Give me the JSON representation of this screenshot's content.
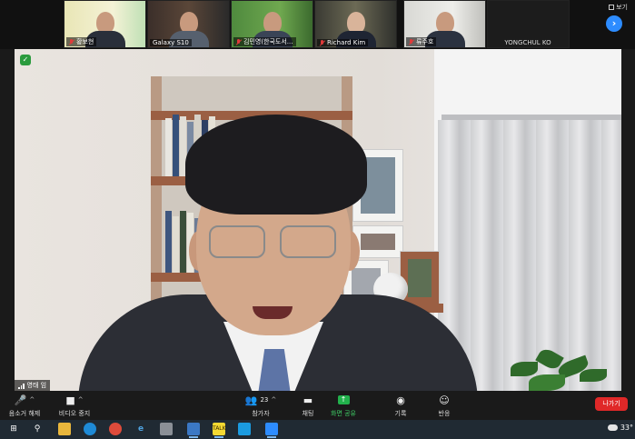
{
  "gallery": {
    "participants": [
      {
        "name": "황보현",
        "muted": true
      },
      {
        "name": "Galaxy S10",
        "muted": false
      },
      {
        "name": "김민영(한국도서...",
        "muted": true
      },
      {
        "name": "Richard Kim",
        "muted": true
      },
      {
        "name": "류주호",
        "muted": true
      },
      {
        "name": "YONGCHUL KO",
        "muted": false
      }
    ],
    "view_label": "보기",
    "next_arrow": "›"
  },
  "main_video": {
    "speaker_name": "영태 임",
    "security_icon": "shield-check-icon"
  },
  "controls": {
    "unmute_label": "음소거 해제",
    "stop_video_label": "비디오 중지",
    "participants_label": "참가자",
    "participants_count": "23",
    "chat_label": "채팅",
    "share_label": "화면 공유",
    "record_label": "기록",
    "reactions_label": "반응",
    "leave_label": "나가기"
  },
  "taskbar": {
    "temperature": "33°"
  },
  "colors": {
    "accent": "#2d8cff",
    "leave": "#e02828",
    "share": "#22b14c",
    "muted": "#e03b3b"
  }
}
